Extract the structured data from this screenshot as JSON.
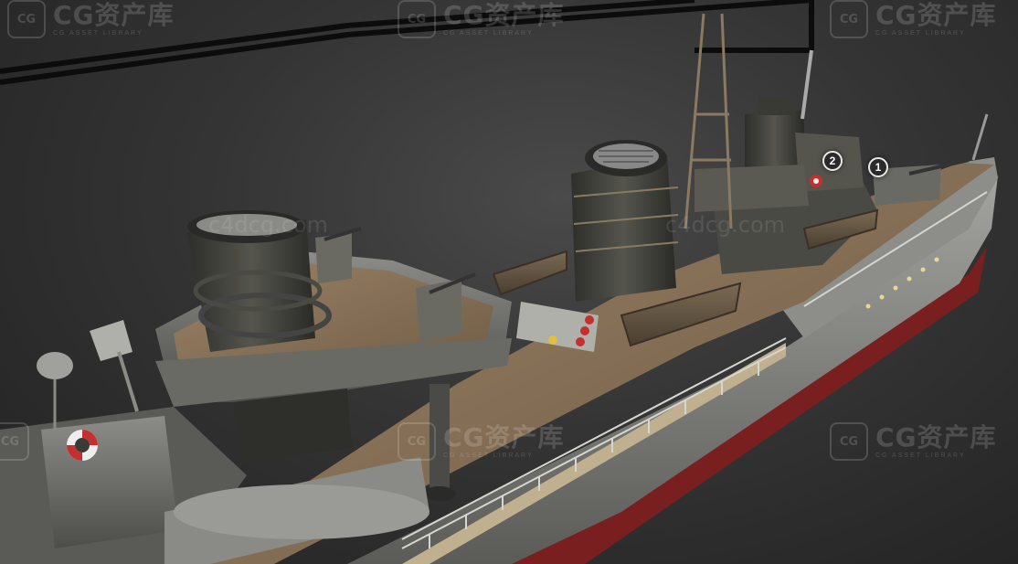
{
  "watermark": {
    "brand_text": "CG资产库",
    "tagline": "CG ASSET LIBRARY",
    "logo_text": "CG"
  },
  "site_mark": "c4dcg.com",
  "annotations": [
    {
      "label": "1"
    },
    {
      "label": "2"
    }
  ],
  "colors": {
    "background": "#333333",
    "deck_wood": "#8a7458",
    "hull_grey": "#7a7a78",
    "hull_red": "#7a1f1f",
    "metal_dark": "#3a3a36"
  }
}
